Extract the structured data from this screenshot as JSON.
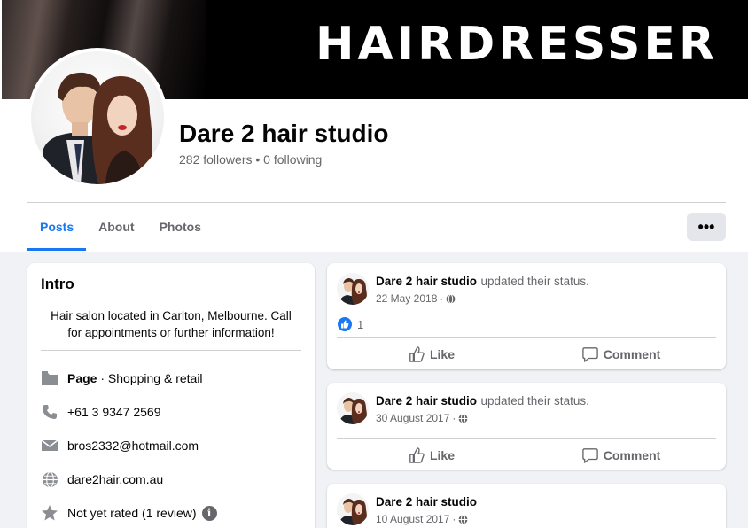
{
  "cover": {
    "title": "HAIRDRESSER"
  },
  "profile": {
    "name": "Dare 2 hair studio",
    "stats": "282 followers • 0 following"
  },
  "tabs": [
    {
      "label": "Posts",
      "active": true
    },
    {
      "label": "About",
      "active": false
    },
    {
      "label": "Photos",
      "active": false
    }
  ],
  "more_label": "•••",
  "intro": {
    "heading": "Intro",
    "bio": "Hair salon located in Carlton, Melbourne. Call for appointments or further information!",
    "page_label": "Page",
    "page_category": " · Shopping & retail",
    "phone": "+61 3 9347 2569",
    "email": "bros2332@hotmail.com",
    "website": "dare2hair.com.au",
    "rating": "Not yet rated (1 review)",
    "info_glyph": "i"
  },
  "posts": [
    {
      "author": "Dare 2 hair studio",
      "action": "updated their status.",
      "date": "22 May 2018",
      "likes": "1",
      "like_label": "Like",
      "comment_label": "Comment"
    },
    {
      "author": "Dare 2 hair studio",
      "action": "updated their status.",
      "date": "30 August 2017",
      "like_label": "Like",
      "comment_label": "Comment"
    },
    {
      "author": "Dare 2 hair studio",
      "action": "",
      "date": "10 August 2017"
    }
  ],
  "date_separator": "·",
  "colors": {
    "accent": "#1877f2",
    "secondary_text": "#65676b",
    "background": "#f0f2f5"
  },
  "icons": [
    "page-icon",
    "phone-icon",
    "email-icon",
    "globe-icon",
    "star-icon",
    "info-icon",
    "like-icon",
    "comment-icon",
    "thumbs-up-reaction-icon"
  ]
}
